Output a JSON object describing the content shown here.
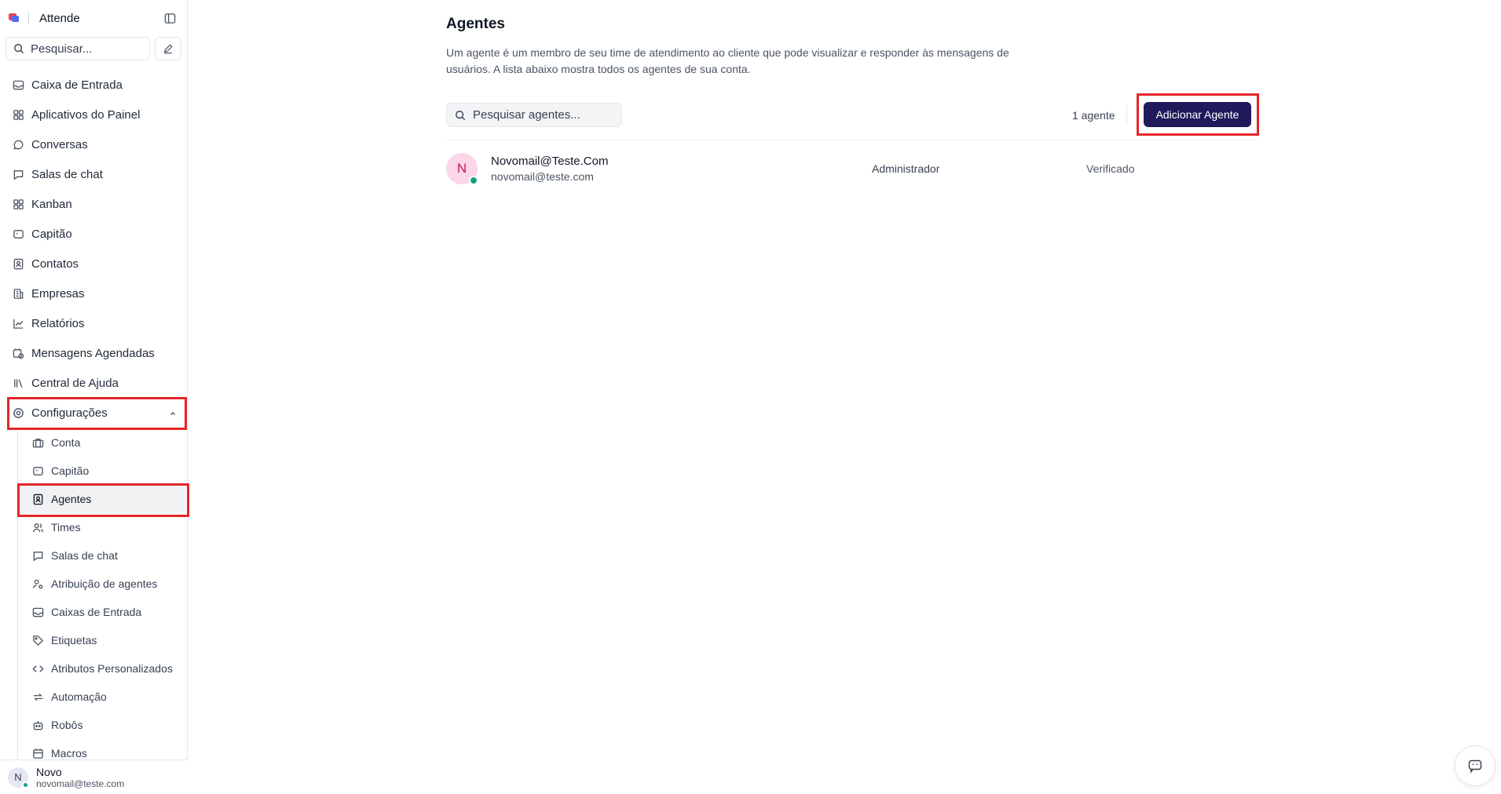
{
  "app": {
    "name": "Attende"
  },
  "sidebar": {
    "search_placeholder": "Pesquisar...",
    "items": [
      {
        "label": "Caixa de Entrada",
        "icon": "inbox-icon"
      },
      {
        "label": "Aplicativos do Painel",
        "icon": "apps-icon"
      },
      {
        "label": "Conversas",
        "icon": "chat-bubble-icon"
      },
      {
        "label": "Salas de chat",
        "icon": "message-square-icon"
      },
      {
        "label": "Kanban",
        "icon": "kanban-icon"
      },
      {
        "label": "Capitão",
        "icon": "captain-icon"
      },
      {
        "label": "Contatos",
        "icon": "contact-card-icon"
      },
      {
        "label": "Empresas",
        "icon": "building-icon"
      },
      {
        "label": "Relatórios",
        "icon": "chart-line-icon"
      },
      {
        "label": "Mensagens Agendadas",
        "icon": "calendar-clock-icon"
      },
      {
        "label": "Central de Ajuda",
        "icon": "library-icon"
      },
      {
        "label": "Configurações",
        "icon": "settings-icon",
        "expanded": true
      }
    ],
    "settings_items": [
      {
        "label": "Conta",
        "icon": "briefcase-icon"
      },
      {
        "label": "Capitão",
        "icon": "captain-icon"
      },
      {
        "label": "Agentes",
        "icon": "contact-card-icon",
        "active": true
      },
      {
        "label": "Times",
        "icon": "users-icon"
      },
      {
        "label": "Salas de chat",
        "icon": "message-square-icon"
      },
      {
        "label": "Atribuição de agentes",
        "icon": "user-cog-icon"
      },
      {
        "label": "Caixas de Entrada",
        "icon": "inbox-icon"
      },
      {
        "label": "Etiquetas",
        "icon": "tag-icon"
      },
      {
        "label": "Atributos Personalizados",
        "icon": "code-icon"
      },
      {
        "label": "Automação",
        "icon": "repeat-icon"
      },
      {
        "label": "Robôs",
        "icon": "bot-icon"
      },
      {
        "label": "Macros",
        "icon": "calendar-icon"
      }
    ],
    "user": {
      "initial": "N",
      "name": "Novo",
      "email": "novomail@teste.com"
    }
  },
  "main": {
    "title": "Agentes",
    "description": "Um agente é um membro de seu time de atendimento ao cliente que pode visualizar e responder às mensagens de usuários. A lista abaixo mostra todos os agentes de sua conta.",
    "search_placeholder": "Pesquisar agentes...",
    "count_label": "1 agente",
    "add_button": "Adicionar Agente",
    "agents": [
      {
        "initial": "N",
        "name": "Novomail@Teste.Com",
        "email": "novomail@teste.com",
        "role": "Administrador",
        "status": "Verificado"
      }
    ]
  },
  "colors": {
    "accent": "#1f1a5c",
    "highlight": "#e5252a",
    "online": "#10a37f"
  }
}
